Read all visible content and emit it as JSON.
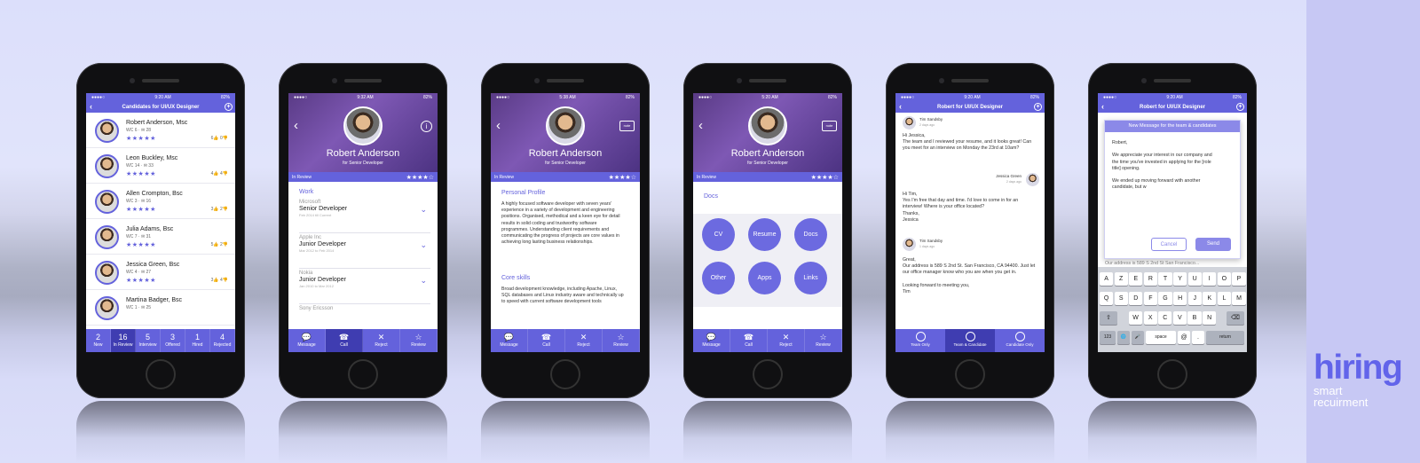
{
  "brand": {
    "name": "hiring",
    "tagline_1": "smart",
    "tagline_2": "recuirment",
    "color": "#6264ea"
  },
  "colors": {
    "primary": "#6462dc",
    "primary_dark": "#3f3db1"
  },
  "status": {
    "carrier": "●●●●○",
    "battery": "82%"
  },
  "phone1": {
    "time": "9:20 AM",
    "nav_title": "Candidates for UI/UX Designer",
    "candidates": [
      {
        "name": "Robert Anderson, Msc",
        "meta": "WC 6 · ✉ 28",
        "stars": "★★★★★",
        "likes": "6👍 0👎"
      },
      {
        "name": "Leon Buckley, Msc",
        "meta": "WC 14 · ✉ 33",
        "stars": "★★★★★",
        "likes": "4👍 4👎"
      },
      {
        "name": "Allen Crompton, Bsc",
        "meta": "WC 3 · ✉ 16",
        "stars": "★★★★★",
        "likes": "3👍 2👎"
      },
      {
        "name": "Julia Adams, Bsc",
        "meta": "WC 7 · ✉ 31",
        "stars": "★★★★★",
        "likes": "5👍 2👎"
      },
      {
        "name": "Jessica Green, Bsc",
        "meta": "WC 4 · ✉ 27",
        "stars": "★★★★★",
        "likes": "3👍 4👎"
      },
      {
        "name": "Martina Badger, Bsc",
        "meta": "WC 1 · ✉ 25",
        "stars": "",
        "likes": ""
      }
    ],
    "tabs": [
      {
        "count": "2",
        "label": "New"
      },
      {
        "count": "16",
        "label": "In Review"
      },
      {
        "count": "5",
        "label": "Interview"
      },
      {
        "count": "3",
        "label": "Offered"
      },
      {
        "count": "1",
        "label": "Hired"
      },
      {
        "count": "4",
        "label": "Rejected"
      }
    ]
  },
  "profile": {
    "name": "Robert Anderson",
    "role": "for Senior Developer",
    "status": "In Review",
    "stars": "★★★★☆",
    "info_icon": "i",
    "note_label": "note"
  },
  "phone2": {
    "time": "9:32 AM",
    "section": "Work",
    "jobs": [
      {
        "company": "Microsoft",
        "title": "Senior Developer",
        "dates": "Feb 2014 till Current"
      },
      {
        "company": "Apple Inc",
        "title": "Junior Developer",
        "dates": "Mar 2012 to Feb 2014"
      },
      {
        "company": "Nokia",
        "title": "Junior Developer",
        "dates": "Jan 2010 to Mar 2012"
      },
      {
        "company": "Sony Ericsson",
        "title": "",
        "dates": ""
      }
    ]
  },
  "actions": [
    {
      "icon": "💬",
      "label": "Message"
    },
    {
      "icon": "☎",
      "label": "Call"
    },
    {
      "icon": "✕",
      "label": "Reject"
    },
    {
      "icon": "☆",
      "label": "Review"
    }
  ],
  "phone3": {
    "time": "5:38 AM",
    "section1": "Personal Profile",
    "text1": "A highly focused software developer with seven years' experience in a variety of development and engineering positions. Organised, methodical and a keen eye for detail results in solid coding and trustworthy software programmes. Understanding client requirements and communicating the progress of projects are core values in achieving long lasting business relationships.",
    "section2": "Core skills",
    "text2": "Broad development knowledge, including Apache, Linux, SQL databases and Linux industry aware and technically up to speed with current software development tools"
  },
  "phone4": {
    "time": "5:20 AM",
    "section": "Docs",
    "docs": [
      "CV",
      "Resume",
      "Docs",
      "Other",
      "Apps",
      "Links"
    ]
  },
  "phone5": {
    "time": "9:20 AM",
    "nav_title": "Robert for UI/UX Designer",
    "m1_name": "Tim Sandsby",
    "m1_time": "2 days ago",
    "m1_text": "Hi Jessica,\nThe team and I reviewed your resume, and it looks great! Can you meet for an interview on Monday the 23rd at 10am?",
    "m2_name": "Jessica Green",
    "m2_time": "2 days ago",
    "m2_text": "Hi Tim,\nYes I'm free that day and time. I'd love to come in for an interview! Where is your office located?\nThanks,\nJessica",
    "m3_name": "Tim Sandsby",
    "m3_time": "1 days ago",
    "m3_text": "Great,\nOur address is 589 S 2nd St. San Francisco, CA 94400. Just let our office manager know who you are when you get in.\n\nLooking forward to meeting you,\nTim",
    "options": [
      "Team Only",
      "Team & Candidate",
      "Candidate Only"
    ]
  },
  "phone6": {
    "time": "9:20 AM",
    "nav_title": "Robert for UI/UX Designer",
    "dialog_title": "New Message for the team & candidates",
    "dialog_text": "Robert,\n\nWe appreciate your interest in our company and the time you've invested in applying for the [role title] opening.\n\nWe ended up moving forward with another candidate, but w",
    "cancel": "Cancel",
    "send": "Send",
    "behind_text": "Our address is 589 S 2nd St San Francisco...",
    "kb_row1": [
      "A",
      "Z",
      "E",
      "R",
      "T",
      "Y",
      "U",
      "I",
      "O",
      "P"
    ],
    "kb_row2": [
      "Q",
      "S",
      "D",
      "F",
      "G",
      "H",
      "J",
      "K",
      "L",
      "M"
    ],
    "kb_row3": [
      "W",
      "X",
      "C",
      "V",
      "B",
      "N"
    ],
    "kb_num": "123",
    "kb_globe": "🌐",
    "kb_mic": "🎤",
    "kb_space": "space",
    "kb_at": "@",
    "kb_dot": ".",
    "kb_return": "return",
    "kb_shift": "⇧",
    "kb_back": "⌫"
  }
}
